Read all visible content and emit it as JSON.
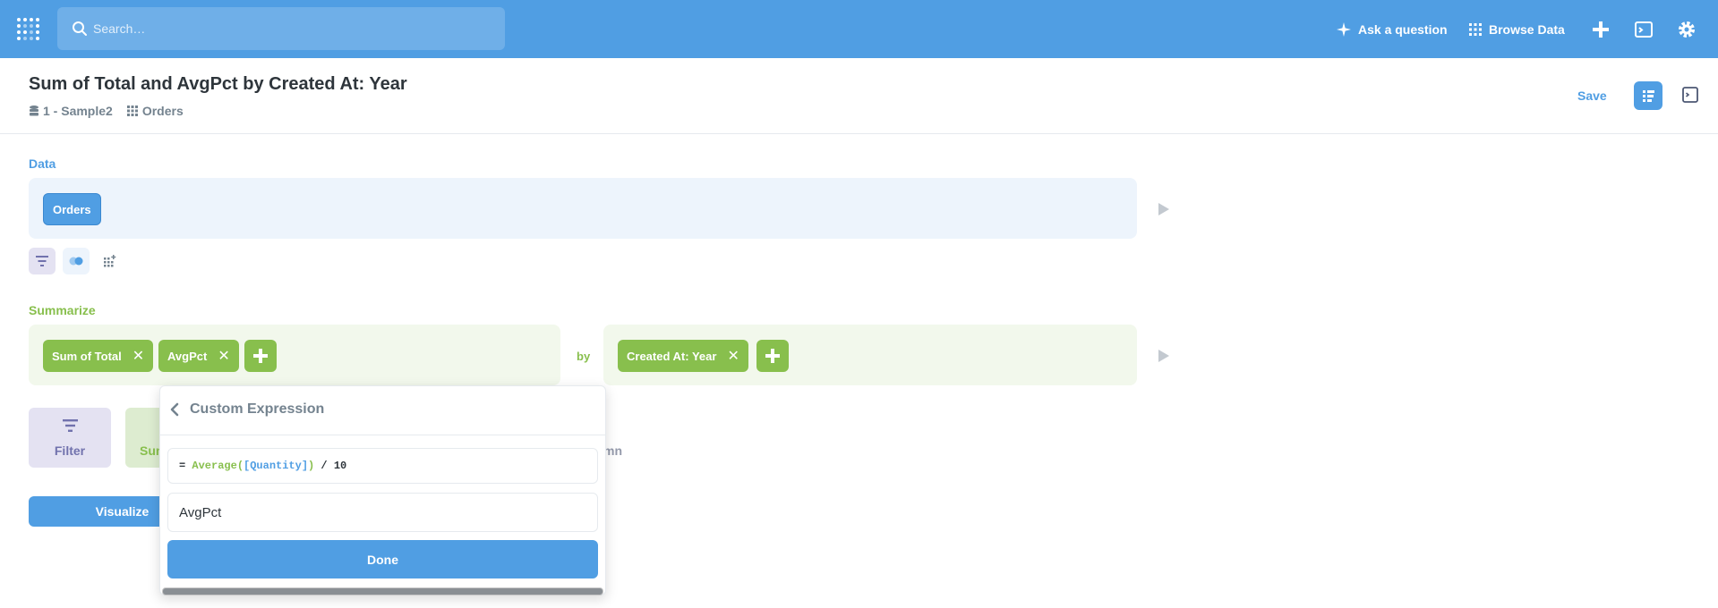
{
  "nav": {
    "search_placeholder": "Search…",
    "ask_question": "Ask a question",
    "browse_data": "Browse Data"
  },
  "header": {
    "title": "Sum of Total and AvgPct by Created At: Year",
    "breadcrumb": [
      "1 - Sample2",
      "Orders"
    ],
    "save": "Save"
  },
  "data_section": {
    "label": "Data",
    "table": "Orders"
  },
  "summarize_section": {
    "label": "Summarize",
    "metrics": [
      "Sum of Total",
      "AvgPct"
    ],
    "by_label": "by",
    "groupings": [
      "Created At: Year"
    ]
  },
  "actions": {
    "filter": "Filter",
    "summarize_fragment": "Sum",
    "column_fragment": "mn",
    "visualize": "Visualize"
  },
  "popover": {
    "title": "Custom Expression",
    "expression": {
      "eq": "= ",
      "func": "Average(",
      "field": "[Quantity]",
      "close": ")",
      "rest": " / 10"
    },
    "name_value": "AvgPct",
    "done": "Done"
  },
  "colors": {
    "brand": "#509ee3",
    "summarize": "#88bf4d",
    "filter": "#7172ad"
  }
}
